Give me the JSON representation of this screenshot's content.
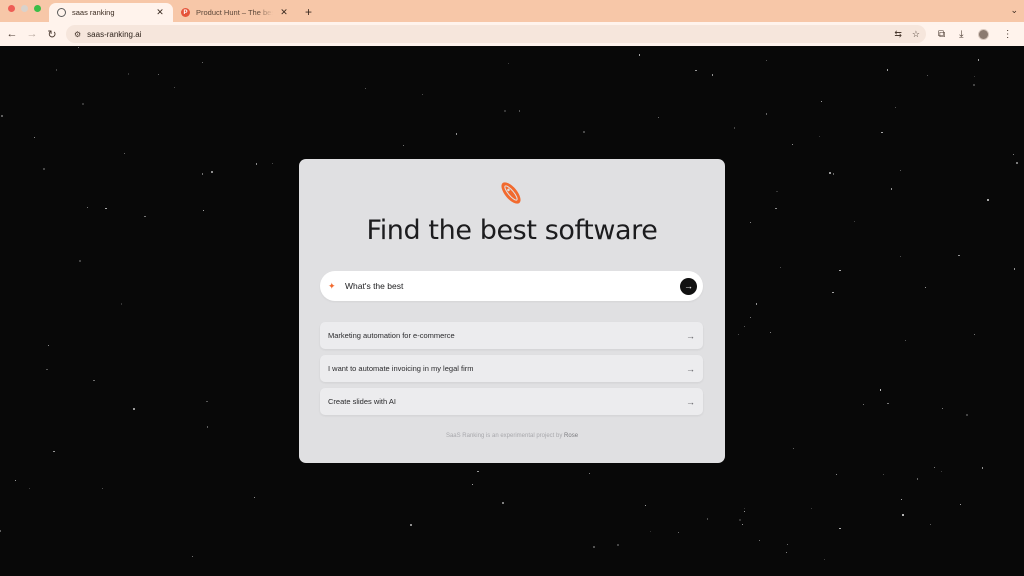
{
  "browser": {
    "tabs": [
      {
        "title": "saas ranking",
        "favicon": "globe-icon",
        "active": true
      },
      {
        "title": "Product Hunt – The best new",
        "favicon": "product-hunt-icon",
        "active": false
      }
    ],
    "new_tab_symbol": "+",
    "url": "saas-ranking.ai"
  },
  "icons": {
    "back": "←",
    "forward": "→",
    "reload": "↻",
    "tune": "⚙",
    "translate": "⇆",
    "star": "☆",
    "extensions": "⧉",
    "download": "⤓",
    "menu": "⋮",
    "tab_close": "✕",
    "tab_menu": "⌄",
    "sparkle": "✦",
    "send": "→",
    "suggestion_arrow": "→"
  },
  "colors": {
    "tab_strip": "#f7c7a8",
    "accent_orange": "#f26a2e",
    "card_bg": "#e0e0e2"
  },
  "main": {
    "headline": "Find the best software",
    "search": {
      "value": "What's the best",
      "placeholder": ""
    },
    "suggestions": [
      {
        "label": "Marketing automation for e-commerce"
      },
      {
        "label": "I want to automate invoicing in my legal firm"
      },
      {
        "label": "Create slides with AI"
      }
    ],
    "footer": {
      "text": "SaaS Ranking is an experimental project by",
      "author": "Rose"
    }
  }
}
